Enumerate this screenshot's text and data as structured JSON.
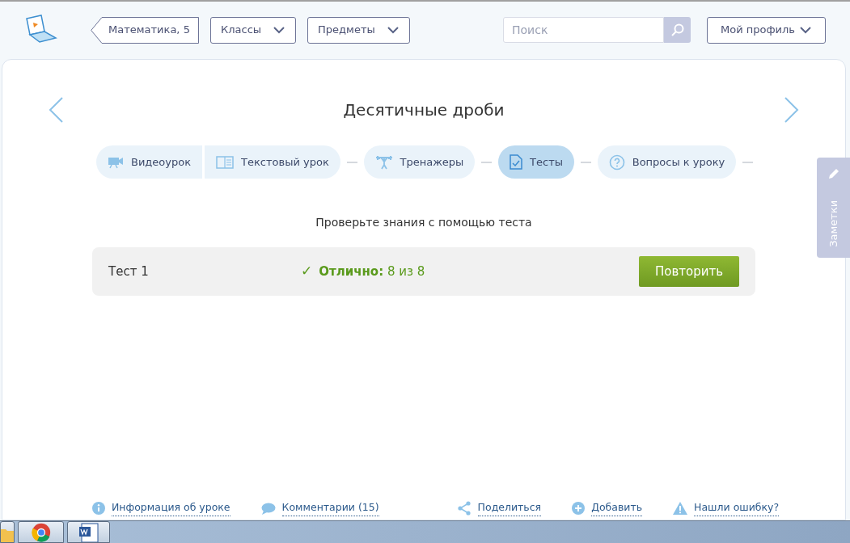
{
  "header": {
    "breadcrumb": "Математика, 5",
    "menus": [
      "Классы",
      "Предметы"
    ],
    "search": {
      "placeholder": "Поиск"
    },
    "profile": "Мой профиль"
  },
  "lesson": {
    "title": "Десятичные дроби",
    "tab_groups": [
      [
        {
          "kind": "video",
          "label": "Видеоурок",
          "selected": false
        },
        {
          "kind": "text",
          "label": "Текстовый урок",
          "selected": false
        }
      ],
      [
        {
          "kind": "trainer",
          "label": "Тренажеры",
          "selected": false
        }
      ],
      [
        {
          "kind": "test",
          "label": "Тесты",
          "selected": true
        }
      ],
      [
        {
          "kind": "question",
          "label": "Вопросы к уроку",
          "selected": false
        }
      ]
    ],
    "prompt": "Проверьте знания с помощью теста",
    "tests": [
      {
        "name": "Тест 1",
        "mark": "✓",
        "result": "**Отлично:** 8 из 8",
        "button": "Повторить"
      }
    ]
  },
  "notes_tab": "Заметки",
  "footer_links": [
    {
      "kind": "info",
      "label": "Информация об уроке"
    },
    {
      "kind": "comment",
      "label": "Комментарии (15)"
    },
    {
      "kind": "share",
      "label": "Поделиться"
    },
    {
      "kind": "add",
      "label": "Добавить"
    },
    {
      "kind": "warning",
      "label": "Нашли ошибку?"
    }
  ],
  "taskbar": [
    {
      "kind": "folder"
    },
    {
      "kind": "browser"
    },
    {
      "kind": "document"
    }
  ]
}
